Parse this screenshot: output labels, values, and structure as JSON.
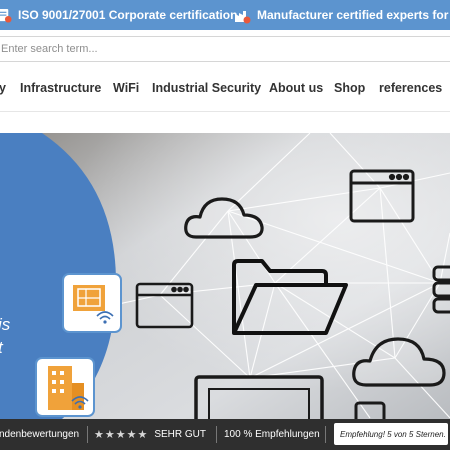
{
  "topbar": {
    "cert_text": "ISO 9001/27001 Corporate certification",
    "experts_text": "Manufacturer certified experts for your p",
    "background": "#5c94cf",
    "icons": [
      "certificate-badge-icon",
      "factory-badge-icon"
    ]
  },
  "search": {
    "placeholder": "Enter search term..."
  },
  "nav": {
    "items": [
      {
        "label": "y"
      },
      {
        "label": "Infrastructure"
      },
      {
        "label": "WiFi"
      },
      {
        "label": "Industrial Security"
      },
      {
        "label": "About us"
      },
      {
        "label": "Shop"
      },
      {
        "label": "references"
      }
    ]
  },
  "hero": {
    "text_fragment_1": "is",
    "text_fragment_2": "t",
    "accent": "#4a7fc1",
    "tile_border": "#5c94cf",
    "tile_accent": "#f0a23a",
    "icons": [
      "cloud-icon",
      "browser-window-icon",
      "folder-icon",
      "server-stack-icon",
      "monitor-icon",
      "tablet-icon",
      "office-building-wifi-icon",
      "blueprint-wifi-icon"
    ]
  },
  "footer": {
    "reviews_text": "ndenbewertungen",
    "stars": "★★★★★",
    "rating_text": "SEHR GUT",
    "recommend_text": "100 % Empfehlungen",
    "badge_text": "Empfehlung! 5 von 5 Sternen.",
    "background": "#2f2f2f"
  }
}
